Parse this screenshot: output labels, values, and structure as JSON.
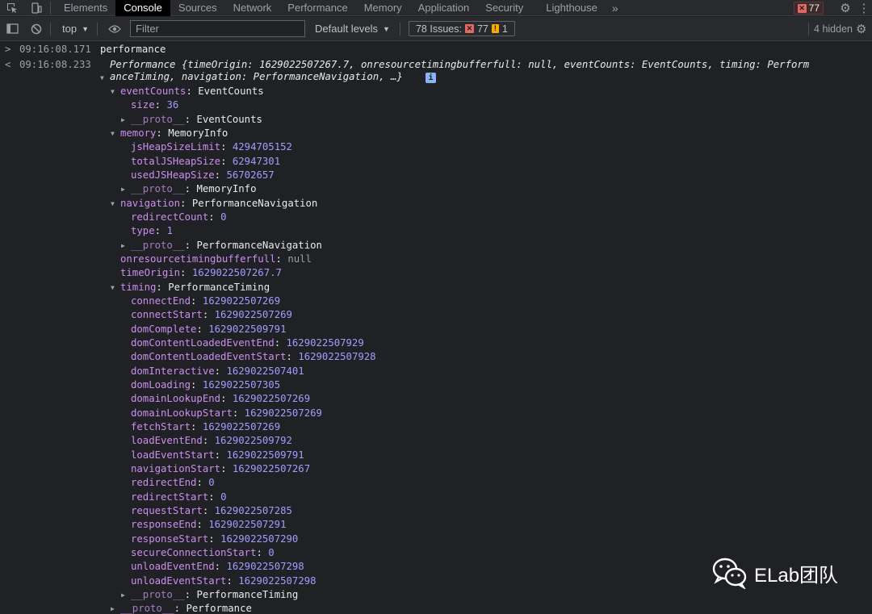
{
  "tabs": [
    "Elements",
    "Console",
    "Sources",
    "Network",
    "Performance",
    "Memory",
    "Application",
    "Security",
    "Lighthouse"
  ],
  "active_tab": "Console",
  "error_count": "77",
  "toolbar": {
    "context": "top",
    "filter_placeholder": "Filter",
    "levels": "Default levels",
    "issues_label": "78 Issues:",
    "issues_errors": "77",
    "issues_warnings": "1",
    "hidden": "4 hidden"
  },
  "input_line": {
    "time": "09:16:08.171",
    "command": "performance"
  },
  "result_line": {
    "time": "09:16:08.233",
    "summary_1": "Performance {timeOrigin: 1629022507267.7, onresourcetimingbufferfull: null, eventCounts: EventCounts, timing: Perform",
    "summary_2": "anceTiming, navigation: PerformanceNavigation, …}"
  },
  "tree": [
    {
      "key": "eventCounts",
      "value": "EventCounts",
      "kind": "obj",
      "depth": 1,
      "expanded": true
    },
    {
      "key": "size",
      "value": "36",
      "kind": "num",
      "depth": 2
    },
    {
      "key": "__proto__",
      "value": "EventCounts",
      "kind": "obj",
      "depth": 2,
      "expanded": false,
      "dim": true
    },
    {
      "key": "memory",
      "value": "MemoryInfo",
      "kind": "obj",
      "depth": 1,
      "expanded": true
    },
    {
      "key": "jsHeapSizeLimit",
      "value": "4294705152",
      "kind": "num",
      "depth": 2
    },
    {
      "key": "totalJSHeapSize",
      "value": "62947301",
      "kind": "num",
      "depth": 2
    },
    {
      "key": "usedJSHeapSize",
      "value": "56702657",
      "kind": "num",
      "depth": 2
    },
    {
      "key": "__proto__",
      "value": "MemoryInfo",
      "kind": "obj",
      "depth": 2,
      "expanded": false,
      "dim": true
    },
    {
      "key": "navigation",
      "value": "PerformanceNavigation",
      "kind": "obj",
      "depth": 1,
      "expanded": true
    },
    {
      "key": "redirectCount",
      "value": "0",
      "kind": "num",
      "depth": 2
    },
    {
      "key": "type",
      "value": "1",
      "kind": "num",
      "depth": 2
    },
    {
      "key": "__proto__",
      "value": "PerformanceNavigation",
      "kind": "obj",
      "depth": 2,
      "expanded": false,
      "dim": true
    },
    {
      "key": "onresourcetimingbufferfull",
      "value": "null",
      "kind": "null",
      "depth": 1
    },
    {
      "key": "timeOrigin",
      "value": "1629022507267.7",
      "kind": "num",
      "depth": 1
    },
    {
      "key": "timing",
      "value": "PerformanceTiming",
      "kind": "obj",
      "depth": 1,
      "expanded": true
    },
    {
      "key": "connectEnd",
      "value": "1629022507269",
      "kind": "num",
      "depth": 2
    },
    {
      "key": "connectStart",
      "value": "1629022507269",
      "kind": "num",
      "depth": 2
    },
    {
      "key": "domComplete",
      "value": "1629022509791",
      "kind": "num",
      "depth": 2
    },
    {
      "key": "domContentLoadedEventEnd",
      "value": "1629022507929",
      "kind": "num",
      "depth": 2
    },
    {
      "key": "domContentLoadedEventStart",
      "value": "1629022507928",
      "kind": "num",
      "depth": 2
    },
    {
      "key": "domInteractive",
      "value": "1629022507401",
      "kind": "num",
      "depth": 2
    },
    {
      "key": "domLoading",
      "value": "1629022507305",
      "kind": "num",
      "depth": 2
    },
    {
      "key": "domainLookupEnd",
      "value": "1629022507269",
      "kind": "num",
      "depth": 2
    },
    {
      "key": "domainLookupStart",
      "value": "1629022507269",
      "kind": "num",
      "depth": 2
    },
    {
      "key": "fetchStart",
      "value": "1629022507269",
      "kind": "num",
      "depth": 2
    },
    {
      "key": "loadEventEnd",
      "value": "1629022509792",
      "kind": "num",
      "depth": 2
    },
    {
      "key": "loadEventStart",
      "value": "1629022509791",
      "kind": "num",
      "depth": 2
    },
    {
      "key": "navigationStart",
      "value": "1629022507267",
      "kind": "num",
      "depth": 2
    },
    {
      "key": "redirectEnd",
      "value": "0",
      "kind": "num",
      "depth": 2
    },
    {
      "key": "redirectStart",
      "value": "0",
      "kind": "num",
      "depth": 2
    },
    {
      "key": "requestStart",
      "value": "1629022507285",
      "kind": "num",
      "depth": 2
    },
    {
      "key": "responseEnd",
      "value": "1629022507291",
      "kind": "num",
      "depth": 2
    },
    {
      "key": "responseStart",
      "value": "1629022507290",
      "kind": "num",
      "depth": 2
    },
    {
      "key": "secureConnectionStart",
      "value": "0",
      "kind": "num",
      "depth": 2
    },
    {
      "key": "unloadEventEnd",
      "value": "1629022507298",
      "kind": "num",
      "depth": 2
    },
    {
      "key": "unloadEventStart",
      "value": "1629022507298",
      "kind": "num",
      "depth": 2
    },
    {
      "key": "__proto__",
      "value": "PerformanceTiming",
      "kind": "obj",
      "depth": 2,
      "expanded": false,
      "dim": true
    },
    {
      "key": "__proto__",
      "value": "Performance",
      "kind": "obj",
      "depth": 1,
      "expanded": false,
      "dim": true
    }
  ],
  "watermark": "ELab团队",
  "colors": {
    "key": "#cd8ef0",
    "number": "#a59bff",
    "background": "#202124",
    "error": "#e46962",
    "warning": "#f9ab00"
  }
}
